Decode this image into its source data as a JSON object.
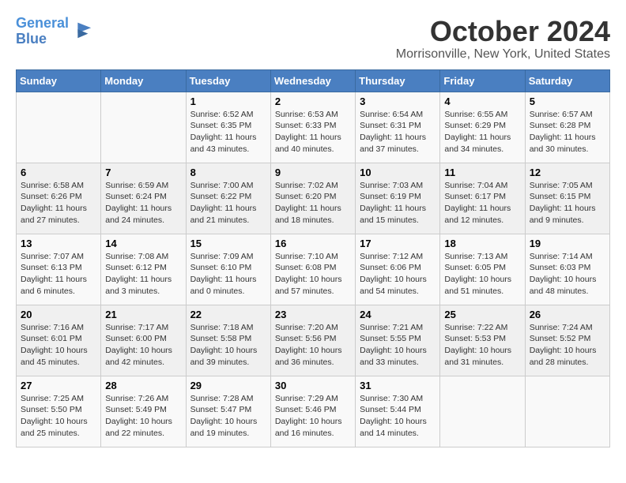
{
  "header": {
    "logo_line1": "General",
    "logo_line2": "Blue",
    "month": "October 2024",
    "location": "Morrisonville, New York, United States"
  },
  "weekdays": [
    "Sunday",
    "Monday",
    "Tuesday",
    "Wednesday",
    "Thursday",
    "Friday",
    "Saturday"
  ],
  "weeks": [
    [
      {
        "day": "",
        "info": ""
      },
      {
        "day": "",
        "info": ""
      },
      {
        "day": "1",
        "info": "Sunrise: 6:52 AM\nSunset: 6:35 PM\nDaylight: 11 hours and 43 minutes."
      },
      {
        "day": "2",
        "info": "Sunrise: 6:53 AM\nSunset: 6:33 PM\nDaylight: 11 hours and 40 minutes."
      },
      {
        "day": "3",
        "info": "Sunrise: 6:54 AM\nSunset: 6:31 PM\nDaylight: 11 hours and 37 minutes."
      },
      {
        "day": "4",
        "info": "Sunrise: 6:55 AM\nSunset: 6:29 PM\nDaylight: 11 hours and 34 minutes."
      },
      {
        "day": "5",
        "info": "Sunrise: 6:57 AM\nSunset: 6:28 PM\nDaylight: 11 hours and 30 minutes."
      }
    ],
    [
      {
        "day": "6",
        "info": "Sunrise: 6:58 AM\nSunset: 6:26 PM\nDaylight: 11 hours and 27 minutes."
      },
      {
        "day": "7",
        "info": "Sunrise: 6:59 AM\nSunset: 6:24 PM\nDaylight: 11 hours and 24 minutes."
      },
      {
        "day": "8",
        "info": "Sunrise: 7:00 AM\nSunset: 6:22 PM\nDaylight: 11 hours and 21 minutes."
      },
      {
        "day": "9",
        "info": "Sunrise: 7:02 AM\nSunset: 6:20 PM\nDaylight: 11 hours and 18 minutes."
      },
      {
        "day": "10",
        "info": "Sunrise: 7:03 AM\nSunset: 6:19 PM\nDaylight: 11 hours and 15 minutes."
      },
      {
        "day": "11",
        "info": "Sunrise: 7:04 AM\nSunset: 6:17 PM\nDaylight: 11 hours and 12 minutes."
      },
      {
        "day": "12",
        "info": "Sunrise: 7:05 AM\nSunset: 6:15 PM\nDaylight: 11 hours and 9 minutes."
      }
    ],
    [
      {
        "day": "13",
        "info": "Sunrise: 7:07 AM\nSunset: 6:13 PM\nDaylight: 11 hours and 6 minutes."
      },
      {
        "day": "14",
        "info": "Sunrise: 7:08 AM\nSunset: 6:12 PM\nDaylight: 11 hours and 3 minutes."
      },
      {
        "day": "15",
        "info": "Sunrise: 7:09 AM\nSunset: 6:10 PM\nDaylight: 11 hours and 0 minutes."
      },
      {
        "day": "16",
        "info": "Sunrise: 7:10 AM\nSunset: 6:08 PM\nDaylight: 10 hours and 57 minutes."
      },
      {
        "day": "17",
        "info": "Sunrise: 7:12 AM\nSunset: 6:06 PM\nDaylight: 10 hours and 54 minutes."
      },
      {
        "day": "18",
        "info": "Sunrise: 7:13 AM\nSunset: 6:05 PM\nDaylight: 10 hours and 51 minutes."
      },
      {
        "day": "19",
        "info": "Sunrise: 7:14 AM\nSunset: 6:03 PM\nDaylight: 10 hours and 48 minutes."
      }
    ],
    [
      {
        "day": "20",
        "info": "Sunrise: 7:16 AM\nSunset: 6:01 PM\nDaylight: 10 hours and 45 minutes."
      },
      {
        "day": "21",
        "info": "Sunrise: 7:17 AM\nSunset: 6:00 PM\nDaylight: 10 hours and 42 minutes."
      },
      {
        "day": "22",
        "info": "Sunrise: 7:18 AM\nSunset: 5:58 PM\nDaylight: 10 hours and 39 minutes."
      },
      {
        "day": "23",
        "info": "Sunrise: 7:20 AM\nSunset: 5:56 PM\nDaylight: 10 hours and 36 minutes."
      },
      {
        "day": "24",
        "info": "Sunrise: 7:21 AM\nSunset: 5:55 PM\nDaylight: 10 hours and 33 minutes."
      },
      {
        "day": "25",
        "info": "Sunrise: 7:22 AM\nSunset: 5:53 PM\nDaylight: 10 hours and 31 minutes."
      },
      {
        "day": "26",
        "info": "Sunrise: 7:24 AM\nSunset: 5:52 PM\nDaylight: 10 hours and 28 minutes."
      }
    ],
    [
      {
        "day": "27",
        "info": "Sunrise: 7:25 AM\nSunset: 5:50 PM\nDaylight: 10 hours and 25 minutes."
      },
      {
        "day": "28",
        "info": "Sunrise: 7:26 AM\nSunset: 5:49 PM\nDaylight: 10 hours and 22 minutes."
      },
      {
        "day": "29",
        "info": "Sunrise: 7:28 AM\nSunset: 5:47 PM\nDaylight: 10 hours and 19 minutes."
      },
      {
        "day": "30",
        "info": "Sunrise: 7:29 AM\nSunset: 5:46 PM\nDaylight: 10 hours and 16 minutes."
      },
      {
        "day": "31",
        "info": "Sunrise: 7:30 AM\nSunset: 5:44 PM\nDaylight: 10 hours and 14 minutes."
      },
      {
        "day": "",
        "info": ""
      },
      {
        "day": "",
        "info": ""
      }
    ]
  ]
}
